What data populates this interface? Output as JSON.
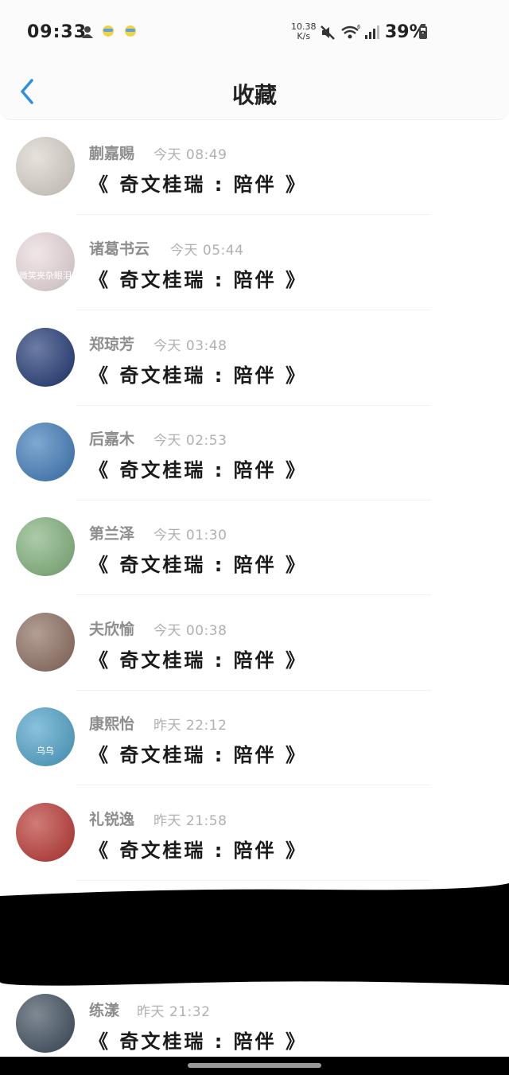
{
  "status_bar": {
    "time": "09:33",
    "net_speed_value": "10.38",
    "net_speed_unit": "K/s",
    "battery": "39%",
    "battery_level": 0.39
  },
  "header": {
    "title": "收藏",
    "back_icon": "chevron-left-icon"
  },
  "favorites": [
    {
      "name": "蒯嘉赐",
      "time": "今天 08:49",
      "content": "《 奇文桂瑞 : 陪伴 》",
      "avatar_color": "#d9d2c9"
    },
    {
      "name": "诸葛书云",
      "time": "今天 05:44",
      "content": "《 奇文桂瑞 : 陪伴 》",
      "avatar_color": "#e9d9dc",
      "avatar_label": "微笑夹杂眼泪"
    },
    {
      "name": "郑琼芳",
      "time": "今天 03:48",
      "content": "《 奇文桂瑞 : 陪伴 》",
      "avatar_color": "#1d3572"
    },
    {
      "name": "后嘉木",
      "time": "今天 02:53",
      "content": "《 奇文桂瑞 : 陪伴 》",
      "avatar_color": "#3b78b8"
    },
    {
      "name": "第兰泽",
      "time": "今天 01:30",
      "content": "《 奇文桂瑞 : 陪伴 》",
      "avatar_color": "#7fb07a"
    },
    {
      "name": "夫欣愉",
      "time": "今天 00:38",
      "content": "《 奇文桂瑞 : 陪伴 》",
      "avatar_color": "#8a6a5c"
    },
    {
      "name": "康熙怡",
      "time": "昨天 22:12",
      "content": "《 奇文桂瑞 : 陪伴 》",
      "avatar_color": "#4aa0c8",
      "avatar_label": "乌乌"
    },
    {
      "name": "礼锐逸",
      "time": "昨天 21:58",
      "content": "《 奇文桂瑞 : 陪伴 》",
      "avatar_color": "#b8342f"
    },
    {
      "name": "练漾",
      "time": "昨天 21:32",
      "content": "《 奇文桂瑞 : 陪伴 》",
      "avatar_color": "#3a4a5a"
    }
  ]
}
